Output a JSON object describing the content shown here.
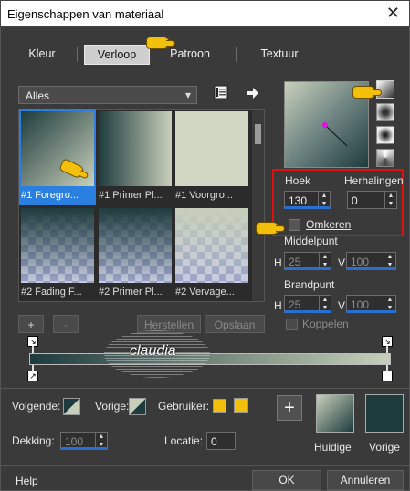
{
  "window": {
    "title": "Eigenschappen van materiaal",
    "close": "✕"
  },
  "tabs": [
    {
      "label": "Kleur"
    },
    {
      "label": "Verloop"
    },
    {
      "label": "Patroon"
    },
    {
      "label": "Textuur"
    }
  ],
  "library": {
    "selected": "Alles",
    "dropdown_arrow": "▾",
    "icons": [
      "palette-book-icon",
      "arrow-right-icon"
    ]
  },
  "thumbnails": [
    {
      "label": "#1 Foregro..."
    },
    {
      "label": "#1 Primer Pl..."
    },
    {
      "label": "#1 Voorgro..."
    },
    {
      "label": "#2 Fading F..."
    },
    {
      "label": "#2 Primer Pl..."
    },
    {
      "label": "#2 Vervage..."
    }
  ],
  "list_buttons": {
    "add": "+",
    "remove": "-",
    "reset": "Herstellen",
    "save": "Opslaan"
  },
  "gradient_colors": {
    "foreground": "#1e3b3d",
    "background": "#c7cfba",
    "accent": "#2a6fcf"
  },
  "angle": {
    "label": "Hoek",
    "value": "130"
  },
  "repeats": {
    "label": "Herhalingen",
    "value": "0"
  },
  "invert": {
    "label": "Omkeren"
  },
  "center": {
    "label": "Middelpunt",
    "h_label": "H",
    "h": "25",
    "v_label": "V",
    "v": "100"
  },
  "focus": {
    "label": "Brandpunt",
    "h_label": "H",
    "h": "25",
    "v_label": "V",
    "v": "100"
  },
  "link": {
    "label": "Koppelen"
  },
  "watermark": {
    "text": "claudia"
  },
  "stop_options": {
    "next": "Volgende:",
    "prev": "Vorige:",
    "user": "Gebruiker:"
  },
  "opacity": {
    "label": "Dekking:",
    "value": "100"
  },
  "location": {
    "label": "Locatie:",
    "value": "0"
  },
  "add_swatch": "+",
  "current_label": "Huidige",
  "previous_label": "Vorige",
  "footer": {
    "help": "Help",
    "ok": "OK",
    "cancel": "Annuleren"
  }
}
